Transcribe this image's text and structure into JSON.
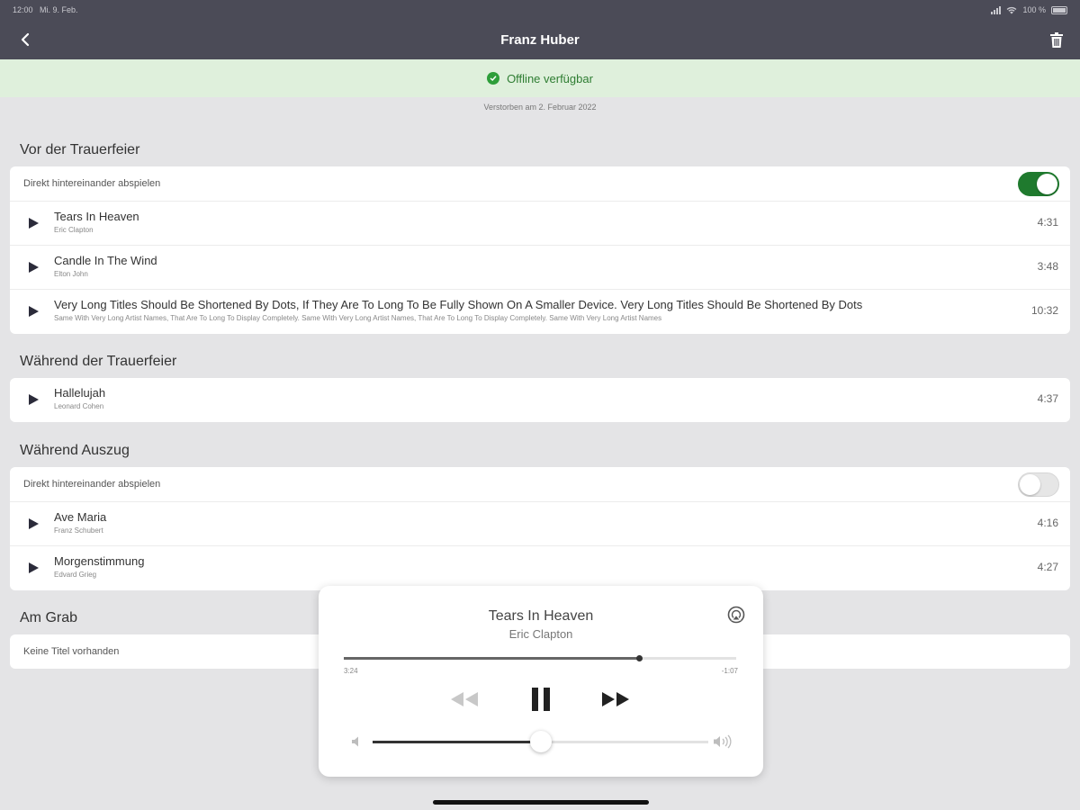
{
  "status": {
    "time": "12:00",
    "date": "Mi. 9. Feb.",
    "battery": "100 %"
  },
  "nav": {
    "title": "Franz Huber"
  },
  "banner": {
    "text": "Offline verfügbar"
  },
  "deceased": "Verstorben am 2. Februar 2022",
  "sections": [
    {
      "title": "Vor der Trauerfeier",
      "autoplay_label": "Direkt hintereinander abspielen",
      "autoplay_on": true,
      "tracks": [
        {
          "title": "Tears In Heaven",
          "artist": "Eric Clapton",
          "duration": "4:31"
        },
        {
          "title": "Candle In The Wind",
          "artist": "Elton John",
          "duration": "3:48"
        },
        {
          "title": "Very Long Titles Should Be Shortened By Dots, If They Are To Long To Be Fully Shown On A Smaller Device. Very Long Titles Should Be Shortened By Dots",
          "artist": "Same With Very Long Artist Names, That Are To Long To Display Completely. Same With Very Long Artist Names, That Are To Long To Display Completely. Same With Very Long Artist Names",
          "duration": "10:32"
        }
      ]
    },
    {
      "title": "Während der Trauerfeier",
      "tracks": [
        {
          "title": "Hallelujah",
          "artist": "Leonard Cohen",
          "duration": "4:37"
        }
      ]
    },
    {
      "title": "Während Auszug",
      "autoplay_label": "Direkt hintereinander abspielen",
      "autoplay_on": false,
      "tracks": [
        {
          "title": "Ave Maria",
          "artist": "Franz Schubert",
          "duration": "4:16"
        },
        {
          "title": "Morgenstimmung",
          "artist": "Edvard Grieg",
          "duration": "4:27"
        }
      ]
    },
    {
      "title": "Am Grab",
      "empty_text": "Keine Titel vorhanden"
    }
  ],
  "player": {
    "title": "Tears In Heaven",
    "artist": "Eric Clapton",
    "elapsed": "3:24",
    "remaining": "-1:07",
    "progress": 0.752,
    "volume": 0.5
  },
  "colors": {
    "nav_bg": "#4b4b57",
    "banner_bg": "#dff0dc",
    "accent_green": "#1f7a2e"
  }
}
